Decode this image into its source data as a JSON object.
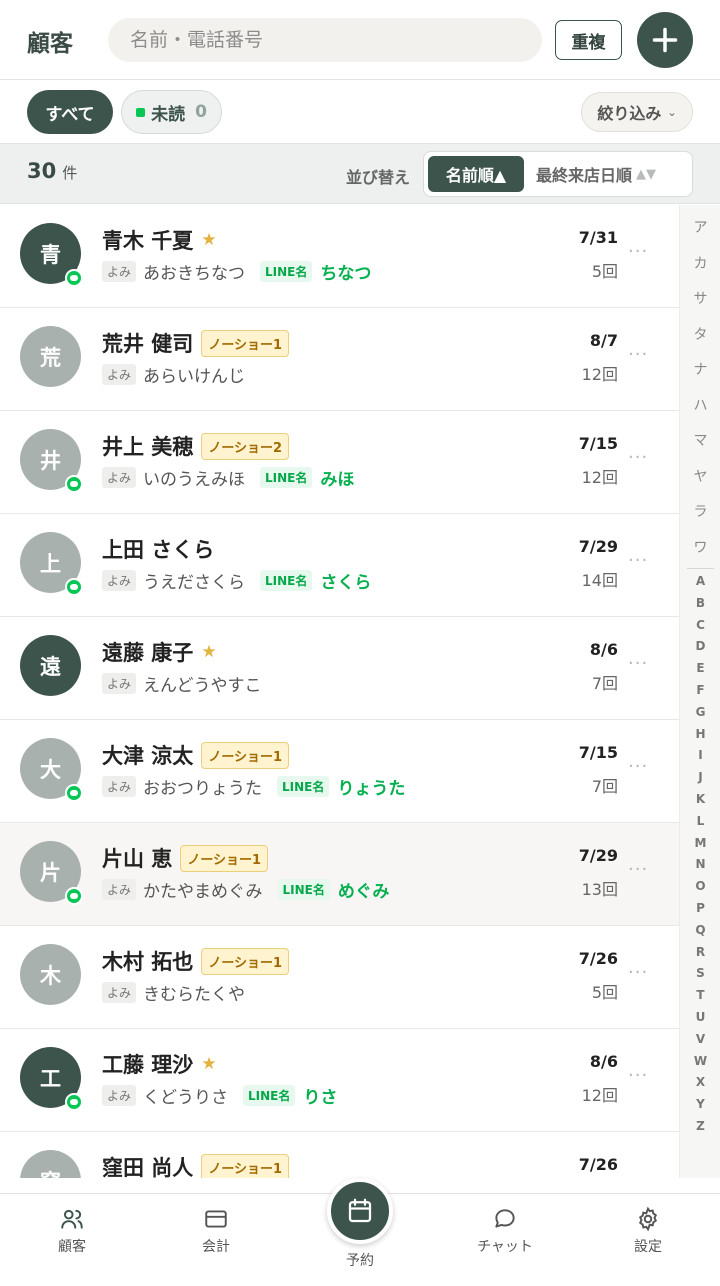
{
  "header": {
    "title": "顧客",
    "search_placeholder": "名前・電話番号",
    "duplicate_label": "重複",
    "add_icon": "plus-icon"
  },
  "filters": {
    "all_label": "すべて",
    "unread_label": "未読",
    "unread_count": "0",
    "refine_label": "絞り込み",
    "refine_icon": "chevron-down-icon"
  },
  "sort": {
    "count": "30",
    "count_unit": "件",
    "label": "並び替え",
    "option_name": "名前順▲",
    "option_last_visit": "最終来店日順",
    "option_last_visit_arrows": "▲▼"
  },
  "customers": [
    {
      "initial": "青",
      "name": "青木 千夏",
      "star": true,
      "noshow": "",
      "yomi": "あおきちなつ",
      "line_name": "ちなつ",
      "date": "7/31",
      "visits": "5回",
      "avatar": "dark",
      "line": true
    },
    {
      "initial": "荒",
      "name": "荒井 健司",
      "star": false,
      "noshow": "ノーショー1",
      "yomi": "あらいけんじ",
      "line_name": "",
      "date": "8/7",
      "visits": "12回",
      "avatar": "light",
      "line": false
    },
    {
      "initial": "井",
      "name": "井上 美穂",
      "star": false,
      "noshow": "ノーショー2",
      "yomi": "いのうえみほ",
      "line_name": "みほ",
      "date": "7/15",
      "visits": "12回",
      "avatar": "light",
      "line": true
    },
    {
      "initial": "上",
      "name": "上田 さくら",
      "star": false,
      "noshow": "",
      "yomi": "うえださくら",
      "line_name": "さくら",
      "date": "7/29",
      "visits": "14回",
      "avatar": "light",
      "line": true
    },
    {
      "initial": "遠",
      "name": "遠藤 康子",
      "star": true,
      "noshow": "",
      "yomi": "えんどうやすこ",
      "line_name": "",
      "date": "8/6",
      "visits": "7回",
      "avatar": "dark",
      "line": false
    },
    {
      "initial": "大",
      "name": "大津 涼太",
      "star": false,
      "noshow": "ノーショー1",
      "yomi": "おおつりょうた",
      "line_name": "りょうた",
      "date": "7/15",
      "visits": "7回",
      "avatar": "light",
      "line": true
    },
    {
      "initial": "片",
      "name": "片山 恵",
      "star": false,
      "noshow": "ノーショー1",
      "yomi": "かたやまめぐみ",
      "line_name": "めぐみ",
      "date": "7/29",
      "visits": "13回",
      "avatar": "light",
      "line": true
    },
    {
      "initial": "木",
      "name": "木村 拓也",
      "star": false,
      "noshow": "ノーショー1",
      "yomi": "きむらたくや",
      "line_name": "",
      "date": "7/26",
      "visits": "5回",
      "avatar": "light",
      "line": false
    },
    {
      "initial": "工",
      "name": "工藤 理沙",
      "star": true,
      "noshow": "",
      "yomi": "くどうりさ",
      "line_name": "りさ",
      "date": "8/6",
      "visits": "12回",
      "avatar": "dark",
      "line": true
    },
    {
      "initial": "窪",
      "name": "窪田 尚人",
      "star": false,
      "noshow": "ノーショー1",
      "yomi": "",
      "line_name": "",
      "date": "7/26",
      "visits": "",
      "avatar": "light",
      "line": false
    }
  ],
  "row_labels": {
    "yomi_tag": "よみ",
    "line_tag": "LINE名",
    "star": "★",
    "more": "···"
  },
  "index": {
    "kana": [
      "ア",
      "カ",
      "サ",
      "タ",
      "ナ",
      "ハ",
      "マ",
      "ヤ",
      "ラ",
      "ワ"
    ],
    "alpha": [
      "A",
      "B",
      "C",
      "D",
      "E",
      "F",
      "G",
      "H",
      "I",
      "J",
      "K",
      "L",
      "M",
      "N",
      "O",
      "P",
      "Q",
      "R",
      "S",
      "T",
      "U",
      "V",
      "W",
      "X",
      "Y",
      "Z"
    ]
  },
  "nav": {
    "customers": "顧客",
    "accounting": "会計",
    "reservation": "予約",
    "chat": "チャット",
    "settings": "設定"
  },
  "colors": {
    "primary": "#3d544c",
    "line_green": "#06c755",
    "star": "#e3b341",
    "noshow_text": "#a36a00",
    "noshow_bg": "#fff4cf"
  }
}
